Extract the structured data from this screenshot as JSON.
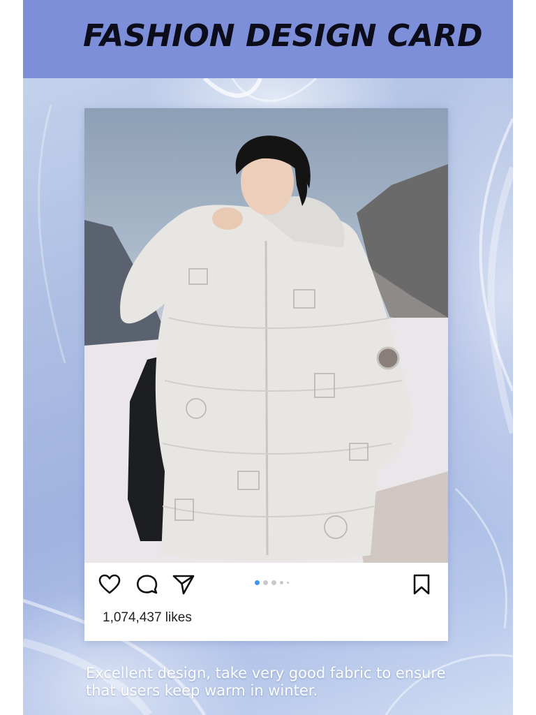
{
  "header": {
    "title": "FASHION DESIGN CARD"
  },
  "colors": {
    "header_bg": "#7d8fd8",
    "accent_dot": "#3897f0"
  },
  "post": {
    "actions": {
      "like_icon": "heart-icon",
      "comment_icon": "speech-bubble-icon",
      "share_icon": "paper-plane-icon",
      "save_icon": "bookmark-icon"
    },
    "carousel": {
      "count": 5,
      "active_index": 0
    },
    "likes": "1,074,437 likes"
  },
  "caption": {
    "line1": "Excellent design, take very good fabric to ensure",
    "line2": "that users keep warm in winter."
  }
}
